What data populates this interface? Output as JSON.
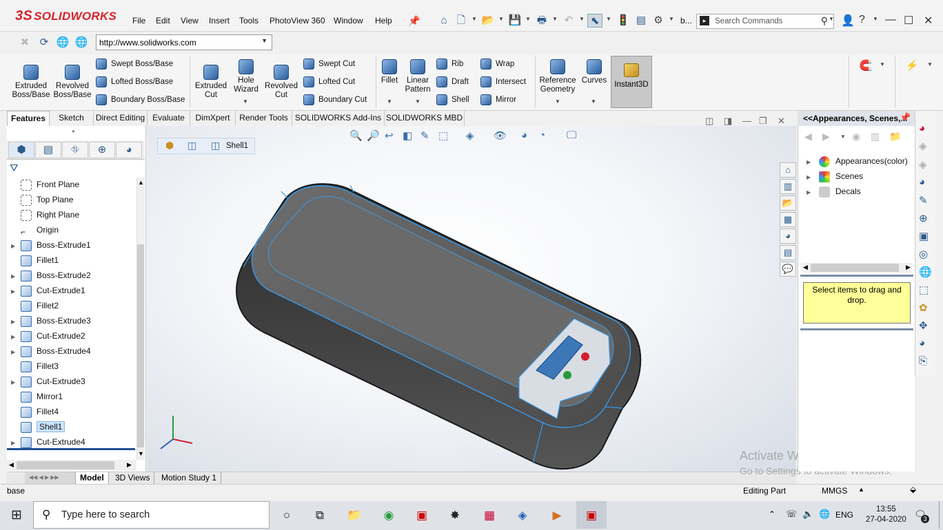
{
  "app": {
    "logo": "SOLIDWORKS",
    "logo_mark": "3S"
  },
  "menu": [
    "File",
    "Edit",
    "View",
    "Insert",
    "Tools",
    "PhotoView 360",
    "Window",
    "Help"
  ],
  "toolbar": {
    "extra_label": "b..."
  },
  "search": {
    "placeholder": "Search Commands"
  },
  "address": {
    "url": "http://www.solidworks.com"
  },
  "ribbon": {
    "big": [
      {
        "label": "Extruded\nBoss/Base"
      },
      {
        "label": "Revolved\nBoss/Base"
      },
      {
        "label": "Extruded\nCut"
      },
      {
        "label": "Hole\nWizard"
      },
      {
        "label": "Revolved\nCut"
      },
      {
        "label": "Fillet"
      },
      {
        "label": "Linear\nPattern"
      },
      {
        "label": "Reference\nGeometry"
      },
      {
        "label": "Curves"
      }
    ],
    "small": [
      "Swept Boss/Base",
      "Lofted Boss/Base",
      "Boundary Boss/Base",
      "Swept Cut",
      "Lofted Cut",
      "Boundary Cut",
      "Rib",
      "Draft",
      "Shell",
      "Wrap",
      "Intersect",
      "Mirror"
    ],
    "instant3d": "Instant3D"
  },
  "tabs": [
    "Features",
    "Sketch",
    "Direct Editing",
    "Evaluate",
    "DimXpert",
    "Render Tools",
    "SOLIDWORKS Add-Ins",
    "SOLIDWORKS MBD"
  ],
  "tree": [
    {
      "label": "Front Plane",
      "type": "plane",
      "expandable": false
    },
    {
      "label": "Top Plane",
      "type": "plane",
      "expandable": false
    },
    {
      "label": "Right Plane",
      "type": "plane",
      "expandable": false
    },
    {
      "label": "Origin",
      "type": "origin",
      "expandable": false
    },
    {
      "label": "Boss-Extrude1",
      "type": "feature",
      "expandable": true
    },
    {
      "label": "Fillet1",
      "type": "feature",
      "expandable": false
    },
    {
      "label": "Boss-Extrude2",
      "type": "feature",
      "expandable": true
    },
    {
      "label": "Cut-Extrude1",
      "type": "feature",
      "expandable": true
    },
    {
      "label": "Fillet2",
      "type": "feature",
      "expandable": false
    },
    {
      "label": "Boss-Extrude3",
      "type": "feature",
      "expandable": true
    },
    {
      "label": "Cut-Extrude2",
      "type": "feature",
      "expandable": true
    },
    {
      "label": "Boss-Extrude4",
      "type": "feature",
      "expandable": true
    },
    {
      "label": "Fillet3",
      "type": "feature",
      "expandable": false
    },
    {
      "label": "Cut-Extrude3",
      "type": "feature",
      "expandable": true
    },
    {
      "label": "Mirror1",
      "type": "feature",
      "expandable": false
    },
    {
      "label": "Fillet4",
      "type": "feature",
      "expandable": false
    },
    {
      "label": "Shell1",
      "type": "feature",
      "expandable": false,
      "selected": true
    },
    {
      "label": "Cut-Extrude4",
      "type": "feature",
      "expandable": true
    }
  ],
  "bottom_tabs": [
    "Model",
    "3D Views",
    "Motion Study 1"
  ],
  "breadcrumb": {
    "label": "Shell1"
  },
  "watermark": {
    "line1": "Activate Windows",
    "line2": "Go to Settings to activate Windows."
  },
  "right_panel": {
    "title": "<<Appearances, Scenes,...",
    "items": [
      "Appearances(color)",
      "Scenes",
      "Decals"
    ],
    "hint": "Select items to drag and drop."
  },
  "status": {
    "left": "base",
    "mode": "Editing Part",
    "units": "MMGS"
  },
  "taskbar": {
    "search_placeholder": "Type here to search",
    "lang": "ENG",
    "time": "13:55",
    "date": "27-04-2020",
    "notif_count": "3"
  }
}
